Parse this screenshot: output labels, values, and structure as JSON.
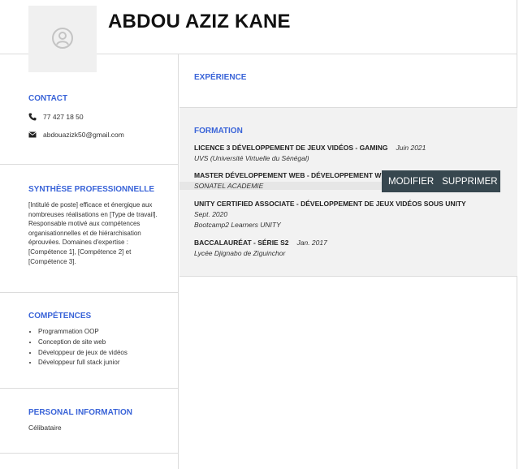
{
  "header": {
    "name": "ABDOU AZIZ KANE",
    "avatar_icon": "user-circle-icon"
  },
  "contact": {
    "title": "CONTACT",
    "phone": "77 427 18 50",
    "email": "abdouazizk50@gmail.com",
    "phone_icon": "phone-icon",
    "email_icon": "envelope-icon"
  },
  "summary": {
    "title": "SYNTHÈSE PROFESSIONNELLE",
    "text": "[Intitulé de poste] efficace et énergique aux nombreuses réalisations en [Type de travail]. Responsable motivé aux compétences organisationnelles et de hiérarchisation éprouvées. Domaines d'expertise : [Compétence 1], [Compétence 2] et [Compétence 3]."
  },
  "skills": {
    "title": "COMPÉTENCES",
    "items": [
      "Programmation OOP",
      "Conception de site web",
      "Développeur de jeux de vidéos",
      "Développeur full stack junior"
    ]
  },
  "personal": {
    "title": "PERSONAL INFORMATION",
    "status": "Célibataire"
  },
  "experience": {
    "title": "EXPÉRIENCE"
  },
  "formation": {
    "title": "FORMATION",
    "entries": [
      {
        "degree": "LICENCE 3 DÉVELOPPEMENT DE JEUX VIDÉOS - GAMING",
        "date": "Juin 2021",
        "school": "UVS (Université Virtuelle du Sénégal)"
      },
      {
        "degree": "MASTER DÉVELOPPEMENT WEB - DÉVELOPPEMENT WE",
        "date": "",
        "school": "SONATEL ACADEMIE"
      },
      {
        "degree": "UNITY CERTIFIED ASSOCIATE - DÉVELOPPEMENT DE JEUX VIDÉOS SOUS UNITY",
        "date": "Sept. 2020",
        "school": "Bootcamp2 Learners UNITY"
      },
      {
        "degree": "BACCALAURÉAT - SÉRIE S2",
        "date": "Jan. 2017",
        "school": "Lycée Djignabo de Ziguinchor"
      }
    ]
  },
  "toolbar": {
    "modify_label": "MODIFIER",
    "delete_label": "SUPPRIMER"
  },
  "colors": {
    "accent": "#3a64d8",
    "toolbar_bg": "#37474f"
  }
}
